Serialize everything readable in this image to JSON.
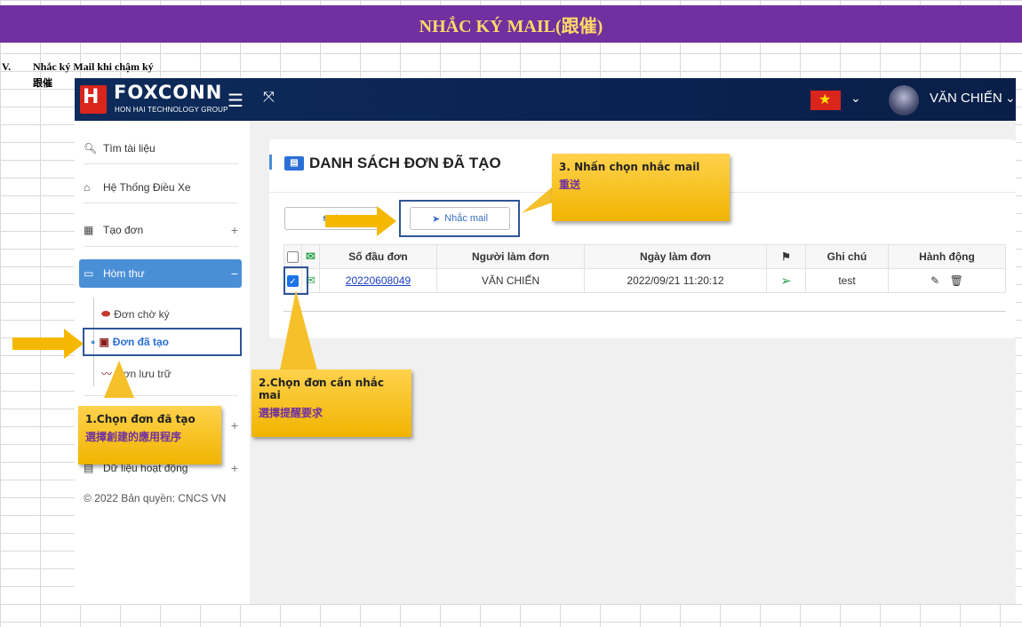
{
  "sheet": {
    "title": "NHẮC KÝ MAIL(跟催)",
    "section_number": "V.",
    "section_title": "Nhắc ký Mail khi chậm ký",
    "section_subtitle": "跟催"
  },
  "app": {
    "brand": "FOXCONN",
    "brand_sub": "HON HAI TECHNOLOGY GROUP",
    "user_name": "VĂN CHIẾN",
    "sidebar": {
      "search_label": "Tìm tài liệu",
      "items": [
        {
          "label": "Hệ Thống Điều Xe"
        },
        {
          "label": "Tạo đơn"
        },
        {
          "label": "Hòm thư"
        }
      ],
      "sub_items": [
        {
          "label": "Đơn chờ ký"
        },
        {
          "label": "Đơn đã tạo"
        },
        {
          "label": "Đơn lưu trữ"
        }
      ],
      "data_item": "Dữ liệu hoạt động",
      "copyright": "© 2022 Bản quyền: CNCS VN"
    },
    "page_title": "DANH SÁCH ĐƠN ĐÃ TẠO",
    "buttons": {
      "refresh_label": "L",
      "remind_label": "Nhắc mail"
    },
    "table": {
      "headers": [
        "Số đầu đơn",
        "Người làm đơn",
        "Ngày làm đơn",
        "Ghi chú",
        "Hành động"
      ],
      "rows": [
        {
          "id": "20220608049",
          "creator": "VĂN CHIẾN",
          "date": "2022/09/21 11:20:12",
          "note": "test"
        }
      ]
    }
  },
  "callouts": {
    "c1_vi": "1.Chọn đơn đã tạo",
    "c1_zh": "選擇創建的應用程序",
    "c2_vi": "2.Chọn đơn cần nhắc mai",
    "c2_zh": "選擇提醒要求",
    "c3_vi": "3. Nhấn chọn nhắc mail",
    "c3_zh": "重送"
  },
  "colors": {
    "title_bar": "#7030a0",
    "title_text": "#ffd966",
    "topbar": "#0d2b5a",
    "active": "#4a8fd6",
    "callout": "#f5c02a",
    "arrow": "#f5b800"
  }
}
